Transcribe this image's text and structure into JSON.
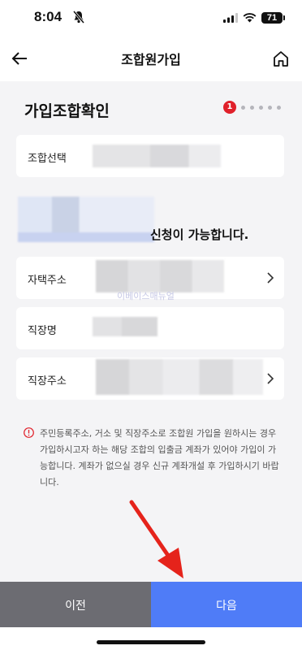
{
  "status_bar": {
    "time": "8:04",
    "battery": "71"
  },
  "header": {
    "title": "조합원가입"
  },
  "section": {
    "title": "가입조합확인",
    "current_step": "1",
    "total_steps": 6
  },
  "fields": {
    "union_select_label": "조합선택",
    "home_address_label": "자택주소",
    "workplace_name_label": "직장명",
    "workplace_address_label": "직장주소"
  },
  "eligibility_message": "신청이 가능합니다.",
  "watermark_text": "이베이스매뉴얼",
  "notice": "주민등록주소, 거소 및 직장주소로 조합원 가입을 원하시는 경우 가입하시고자 하는 해당 조합의 입출금 계좌가 있어야 가입이 가능합니다. 계좌가 없으실 경우 신규 계좌개설 후 가입하시기 바랍니다.",
  "footer": {
    "prev_label": "이전",
    "next_label": "다음"
  },
  "colors": {
    "accent": "#4f7cf7",
    "step_active": "#e0202a",
    "prev_button": "#6c6c72",
    "annotation_arrow": "#e5231b"
  },
  "icons": {
    "back": "arrow-left-icon",
    "home": "home-icon",
    "notice": "exclamation-circle-icon",
    "chevron": "chevron-right-icon"
  }
}
